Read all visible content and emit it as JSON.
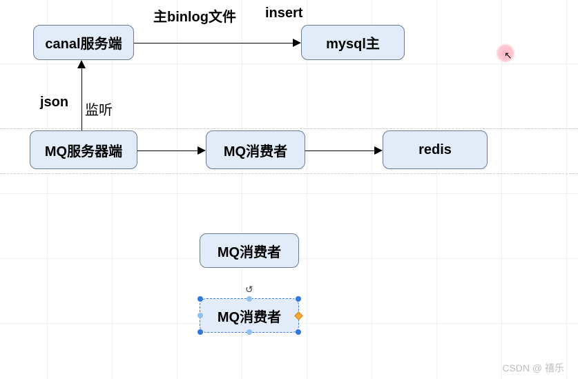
{
  "nodes": {
    "canal": {
      "label": "canal服务端"
    },
    "mysql": {
      "label": "mysql主"
    },
    "mqServer": {
      "label": "MQ服务器端"
    },
    "mqConsumer": {
      "label": "MQ消费者"
    },
    "redis": {
      "label": "redis"
    },
    "mqConsumer2": {
      "label": "MQ消费者"
    },
    "mqConsumer3": {
      "label": "MQ消费者"
    }
  },
  "labels": {
    "binlog": "主binlog文件",
    "insert": "insert",
    "json": "json",
    "listen": "监听"
  },
  "watermark": "CSDN @ 禧乐",
  "chart_data": {
    "type": "flow-diagram",
    "nodes": [
      {
        "id": "canal",
        "label": "canal服务端"
      },
      {
        "id": "mysql",
        "label": "mysql主"
      },
      {
        "id": "mqServer",
        "label": "MQ服务器端"
      },
      {
        "id": "mqConsumer",
        "label": "MQ消费者"
      },
      {
        "id": "redis",
        "label": "redis"
      },
      {
        "id": "mqConsumer2",
        "label": "MQ消费者"
      },
      {
        "id": "mqConsumer3",
        "label": "MQ消费者",
        "selected": true
      }
    ],
    "edges": [
      {
        "from": "canal",
        "to": "mysql",
        "labels": [
          "主binlog文件",
          "insert"
        ]
      },
      {
        "from": "mqServer",
        "to": "canal",
        "labels": [
          "json",
          "监听"
        ]
      },
      {
        "from": "mqServer",
        "to": "mqConsumer"
      },
      {
        "from": "mqConsumer",
        "to": "redis"
      }
    ]
  }
}
